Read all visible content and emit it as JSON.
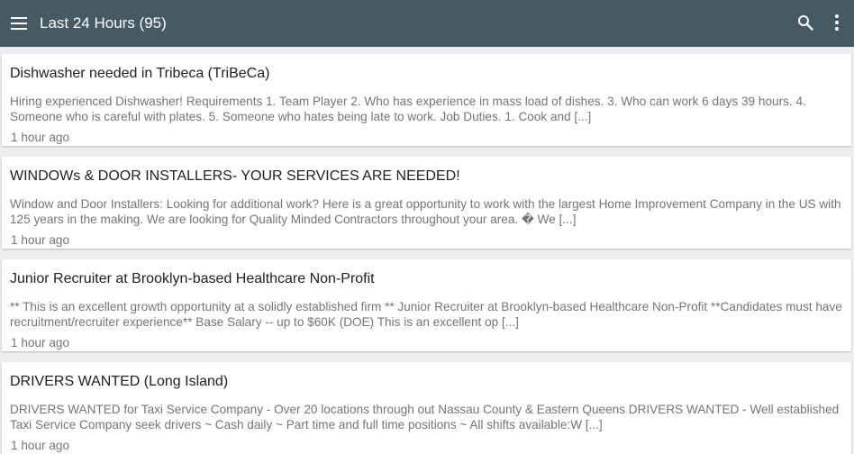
{
  "appbar": {
    "title": "Last 24 Hours (95)",
    "icons": {
      "menu": "hamburger-menu-icon",
      "search": "search-icon",
      "more": "more-vertical-icon"
    },
    "color": "#455a64"
  },
  "listings": [
    {
      "title": "Dishwasher needed in Tribeca (TriBeCa)",
      "description": "Hiring experienced Dishwasher! Requirements 1. Team Player 2. Who has experience in mass load of dishes. 3. Who can work 6 days 39 hours. 4. Someone who is careful with plates. 5. Someone who hates being late to work. Job Duties. 1. Cook and [...]",
      "time": "1 hour ago"
    },
    {
      "title": "WINDOWs & DOOR INSTALLERS- YOUR SERVICES ARE NEEDED!",
      "description": "Window and Door Installers: Looking for additional work? Here is a great opportunity to work with the largest Home Improvement Company in the US with 125 years in the making. We are looking for Quality Minded Contractors throughout your area. � We [...]",
      "time": "1 hour ago"
    },
    {
      "title": "Junior Recruiter at Brooklyn-based Healthcare Non-Profit",
      "description": "** This is an excellent growth opportunity at a solidly established firm ** Junior Recruiter at Brooklyn-based Healthcare Non-Profit **Candidates must have recruitment/recruiter experience** Base Salary -- up to $60K (DOE) This is an excellent op [...]",
      "time": "1 hour ago"
    },
    {
      "title": "DRIVERS WANTED (Long Island)",
      "description": "DRIVERS WANTED for Taxi Service Company - Over 20 locations through out Nassau County & Eastern Queens DRIVERS WANTED - Well established Taxi Service Company seek drivers ~ Cash daily ~ Part time and full time positions ~ All shifts available:W [...]",
      "time": "1 hour ago"
    }
  ]
}
